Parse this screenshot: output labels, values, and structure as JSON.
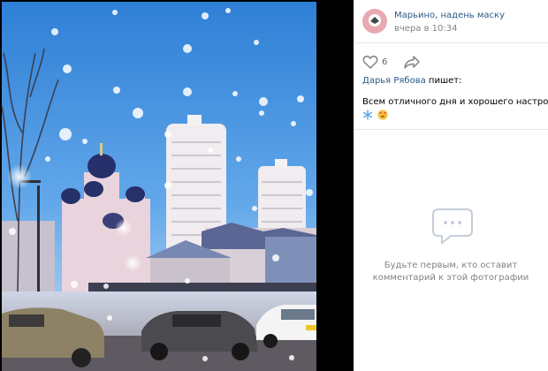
{
  "header": {
    "group_name": "Марьино, надень маску",
    "time": "вчера в 10:34"
  },
  "actions": {
    "like_count": "6"
  },
  "post": {
    "author": "Дарья Рябова",
    "wrote": " пишет:",
    "text": "Всем отличного дня и хорошего настроения"
  },
  "comments": {
    "empty_line1": "Будьте первым, кто оставит",
    "empty_line2": "комментарий к этой фотографии"
  },
  "colors": {
    "link": "#2a5885",
    "muted": "#828282",
    "sky": "#3d8fe0"
  }
}
